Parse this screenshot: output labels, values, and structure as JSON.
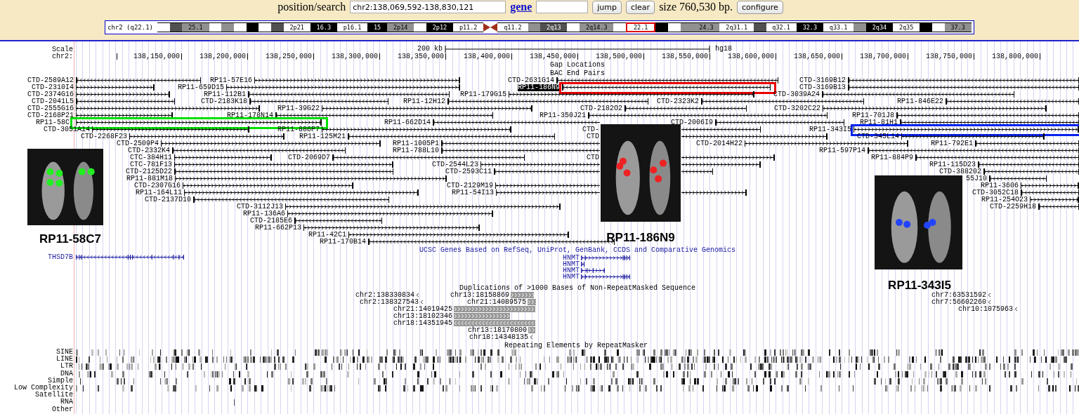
{
  "header": {
    "search_label": "position/search",
    "position_value": "chr2:138,069,592-138,830,121",
    "gene_link": "gene",
    "jump_button": "jump",
    "clear_button": "clear",
    "size_text": "size 760,530 bp.",
    "configure_button": "configure"
  },
  "ideogram": {
    "label": "chr2 (q22.1)",
    "bands": [
      {
        "kind": "gneg",
        "selected": false
      },
      {
        "kind": "gpos75",
        "selected": false
      },
      {
        "label": "25.1",
        "kind": "gpos50",
        "selected": false
      },
      {
        "kind": "gneg",
        "selected": false
      },
      {
        "kind": "gpos50",
        "selected": false
      },
      {
        "kind": "gneg",
        "selected": false
      },
      {
        "kind": "gpos100",
        "selected": false
      },
      {
        "kind": "gneg",
        "selected": false
      },
      {
        "kind": "gpos75",
        "selected": false
      },
      {
        "label": "2p21",
        "kind": "gneg",
        "selected": false
      },
      {
        "label": "16.3",
        "kind": "gpos100",
        "selected": false
      },
      {
        "label": "p16.1",
        "kind": "gneg",
        "selected": false
      },
      {
        "label": "15",
        "kind": "gpos100",
        "selected": false
      },
      {
        "label": "2p14",
        "kind": "gpos50",
        "selected": false
      },
      {
        "kind": "gneg",
        "selected": false
      },
      {
        "label": "2p12",
        "kind": "gpos100",
        "selected": false
      },
      {
        "label": "p11.2",
        "kind": "gneg",
        "selected": false
      },
      {
        "kind": "acenp",
        "selected": false
      },
      {
        "kind": "acenq",
        "selected": false
      },
      {
        "label": "q11.2",
        "kind": "gneg",
        "selected": false
      },
      {
        "kind": "gpos50",
        "selected": false
      },
      {
        "label": "2q13",
        "kind": "gpos75",
        "selected": false
      },
      {
        "kind": "gneg",
        "selected": false
      },
      {
        "label": "2q14.3",
        "kind": "gpos50",
        "selected": false
      },
      {
        "kind": "gneg",
        "selected": false
      },
      {
        "label": "22.1",
        "kind": "gneg",
        "selected": true
      },
      {
        "kind": "gpos100",
        "selected": false
      },
      {
        "kind": "gneg",
        "selected": false
      },
      {
        "kind": "gpos50",
        "selected": false
      },
      {
        "label": "24.3",
        "kind": "gpos50",
        "selected": false
      },
      {
        "label": "2q31.1",
        "kind": "gneg",
        "selected": false
      },
      {
        "kind": "gpos75",
        "selected": false
      },
      {
        "label": "q32.1",
        "kind": "gneg",
        "selected": false
      },
      {
        "label": "32.3",
        "kind": "gpos100",
        "selected": false
      },
      {
        "label": "q33.1",
        "kind": "gneg",
        "selected": false
      },
      {
        "kind": "gpos50",
        "selected": false
      },
      {
        "label": "2q34",
        "kind": "gpos100",
        "selected": false
      },
      {
        "label": "2q35",
        "kind": "gneg",
        "selected": false
      },
      {
        "kind": "gpos100",
        "selected": false
      },
      {
        "kind": "gneg",
        "selected": false
      },
      {
        "label": "37.3",
        "kind": "gpos50",
        "selected": false
      }
    ]
  },
  "ruler": {
    "scale_label": "Scale",
    "chrom_label": "chr2:",
    "scale_bar_label": "200 kb",
    "assembly": "hg18",
    "ticks": [
      "138,150,000",
      "138,200,000",
      "138,250,000",
      "138,300,000",
      "138,350,000",
      "138,400,000",
      "138,450,000",
      "138,500,000",
      "138,550,000",
      "138,600,000",
      "138,650,000",
      "138,700,000",
      "138,750,000",
      "138,800,000"
    ]
  },
  "tracks": {
    "gap_title": "Gap Locations",
    "bac_title": "BAC End Pairs",
    "clones": [
      {
        "label": "CTD-2589A12",
        "kind": "rev",
        "selected": false
      },
      {
        "label": "RP11-57E16",
        "kind": "fwd",
        "selected": false
      },
      {
        "label": "CTD-2631G14",
        "kind": "rev",
        "selected": false
      },
      {
        "label": "CTD-3169B12",
        "kind": "rev",
        "selected": false
      },
      {
        "label": "CTD-2310I4",
        "kind": "fwd",
        "selected": false
      },
      {
        "label": "RP11-659D15",
        "kind": "fwd",
        "selected": false
      },
      {
        "label": "RP11-186N9",
        "kind": "rev",
        "selected": true,
        "color": "#ee0000"
      },
      {
        "label": "CTD-3169B13",
        "kind": "rev",
        "selected": false
      },
      {
        "label": "CTD-2374G16",
        "kind": "fwd",
        "selected": false
      },
      {
        "label": "RP11-112B1",
        "kind": "rev",
        "selected": false
      },
      {
        "label": "RP11-179G15",
        "kind": "fwd",
        "selected": false
      },
      {
        "label": "CTD-3039A24",
        "kind": "rev",
        "selected": false
      },
      {
        "label": "CTD-2041L5",
        "kind": "rev",
        "selected": false
      },
      {
        "label": "CTD-2183K18",
        "kind": "rev",
        "selected": false
      },
      {
        "label": "RP11-12H12",
        "kind": "rev",
        "selected": false
      },
      {
        "label": "CTD-2323K2",
        "kind": "rev",
        "selected": false
      },
      {
        "label": "RP11-846E22",
        "kind": "rev",
        "selected": false
      },
      {
        "label": "CTD-2555G16",
        "kind": "fwd",
        "selected": false
      },
      {
        "label": "RP11-39G22",
        "kind": "fwd",
        "selected": false
      },
      {
        "label": "CTD-2182O2",
        "kind": "rev",
        "selected": false
      },
      {
        "label": "CTD-3202C22",
        "kind": "fwd",
        "selected": false
      },
      {
        "label": "CTD-2168P21",
        "kind": "fwd",
        "selected": false
      },
      {
        "label": "RP11-178N14",
        "kind": "rev",
        "selected": false
      },
      {
        "label": "RP11-350J21",
        "kind": "rev",
        "selected": false
      },
      {
        "label": "RP11-701J8",
        "kind": "rev",
        "selected": false
      },
      {
        "label": "RP11-58C",
        "kind": "fwd",
        "selected": false,
        "color": "#00e000"
      },
      {
        "label": "RP11-662D14",
        "kind": "rev",
        "selected": false
      },
      {
        "label": "CTD-2006I9",
        "kind": "rev",
        "selected": false
      },
      {
        "label": "RP11-81H1",
        "kind": "rev",
        "selected": false
      },
      {
        "label": "CTD-3051A14",
        "kind": "fwd",
        "selected": false
      },
      {
        "label": "RP11-886P7",
        "kind": "fwd",
        "selected": false
      },
      {
        "label": "CTD-",
        "kind": "rev",
        "selected": false
      },
      {
        "label": "RP11-343I5",
        "kind": "fwd",
        "selected": false,
        "color": "#0022ee"
      },
      {
        "label": "CTD-2268F23",
        "kind": "fwd",
        "selected": false
      },
      {
        "label": "RP11-125M21",
        "kind": "rev",
        "selected": false
      },
      {
        "label": "CTD",
        "kind": "fwd",
        "selected": false
      },
      {
        "label": "CTD-345L14",
        "kind": "fwd",
        "selected": false
      },
      {
        "label": "CTD-2509P4",
        "kind": "fwd",
        "selected": false
      },
      {
        "label": "RP11-1005P1",
        "kind": "rev",
        "selected": false
      },
      {
        "label": "CTD-2014H22",
        "kind": "fwd",
        "selected": false
      },
      {
        "label": "RP11-792E1",
        "kind": "rev",
        "selected": false
      },
      {
        "label": "CTD-2332K4",
        "kind": "rev",
        "selected": false
      },
      {
        "label": "RP11-788L10",
        "kind": "rev",
        "selected": false
      },
      {
        "label": "RP11-597P14",
        "kind": "rev",
        "selected": false
      },
      {
        "label": "CTC-384H11",
        "kind": "fwd",
        "selected": false
      },
      {
        "label": "CTD-2069D7",
        "kind": "rev",
        "selected": false
      },
      {
        "label": "CTD",
        "kind": "fwd",
        "selected": false
      },
      {
        "label": "RP11-884P9",
        "kind": "rev",
        "selected": false
      },
      {
        "label": "CTC-781F13",
        "kind": "fwd",
        "selected": false
      },
      {
        "label": "CTD-2544L23",
        "kind": "fwd",
        "selected": false
      },
      {
        "label": "RP11-115D23",
        "kind": "rev",
        "selected": false
      },
      {
        "label": "CTD-2125D22",
        "kind": "rev",
        "selected": false
      },
      {
        "label": "CTD-2593C11",
        "kind": "rev",
        "selected": false
      },
      {
        "label": "CTD-388202",
        "kind": "rev",
        "selected": false
      },
      {
        "label": "RP11-881M18",
        "kind": "fwd",
        "selected": false
      },
      {
        "label": "55J10",
        "kind": "rev",
        "selected": false
      },
      {
        "label": "CTD-2307G16",
        "kind": "fwd",
        "selected": false
      },
      {
        "label": "CTD-2129M19",
        "kind": "fwd",
        "selected": false
      },
      {
        "label": "RP11-3606",
        "kind": "fwd",
        "selected": false
      },
      {
        "label": "RP11-164L11",
        "kind": "fwd",
        "selected": false
      },
      {
        "label": "RP11-54I13",
        "kind": "fwd",
        "selected": false
      },
      {
        "label": "CTD-3052C18",
        "kind": "rev",
        "selected": false
      },
      {
        "label": "CTD-2137D10",
        "kind": "rev",
        "selected": false
      },
      {
        "label": "RP11-254O23",
        "kind": "fwd",
        "selected": false
      },
      {
        "label": "CTD-3112J13",
        "kind": "fwd",
        "selected": false
      },
      {
        "label": "CTD-2259H18",
        "kind": "rev",
        "selected": false
      },
      {
        "label": "RP11-136A6",
        "kind": "fwd",
        "selected": false
      },
      {
        "label": "CTD-2185E6",
        "kind": "rev",
        "selected": false
      },
      {
        "label": "RP11-662P13",
        "kind": "fwd",
        "selected": false
      },
      {
        "label": "RP11-42C1",
        "kind": "fwd",
        "selected": false
      },
      {
        "label": "RP11-170B14",
        "kind": "rev",
        "selected": false
      }
    ],
    "genes_title": "UCSC Genes Based on RefSeq, UniProt, GenBank, CCDS and Comparative Genomics",
    "genes": [
      {
        "name": "THSD7B",
        "kind": "rev"
      },
      {
        "name": "HNMT",
        "kind": "fwd"
      },
      {
        "name": "HNMT",
        "kind": "fwd"
      },
      {
        "name": "HNMT",
        "kind": "fwd"
      },
      {
        "name": "HNMT",
        "kind": "fwd"
      }
    ],
    "dup_title": "Duplications of >1000 Bases of Non-RepeatMasked Sequence",
    "duplications": [
      {
        "label": "chr2:138330834",
        "kind": "rev"
      },
      {
        "label": "chr13:18158869",
        "kind": "fwd"
      },
      {
        "label": "chr2:138327543",
        "kind": "rev"
      },
      {
        "label": "chr21:14089575",
        "kind": "fwd"
      },
      {
        "label": "chr21:14019425",
        "kind": "fwd"
      },
      {
        "label": "chr13:18102346",
        "kind": "fwd"
      },
      {
        "label": "chr18:14351945",
        "kind": "rev"
      },
      {
        "label": "chr13:18170800",
        "kind": "fwd"
      },
      {
        "label": "chr18:14348135",
        "kind": "rev"
      },
      {
        "label": "chr7:63531592",
        "kind": "rev"
      },
      {
        "label": "chr7:56602260",
        "kind": "rev"
      },
      {
        "label": "chr10:1075963",
        "kind": "rev"
      }
    ],
    "repeat_title": "Repeating Elements by RepeatMasker",
    "repeat_classes": [
      "SINE",
      "LINE",
      "LTR",
      "DNA",
      "Simple",
      "Low Complexity",
      "Satellite",
      "RNA",
      "Other"
    ]
  },
  "fish_images": [
    {
      "caption": "RP11-58C7",
      "color": "#22ee22"
    },
    {
      "caption": "RP11-186N9",
      "color": "#ee2222"
    },
    {
      "caption": "RP11-343I5",
      "color": "#2244ff"
    }
  ]
}
